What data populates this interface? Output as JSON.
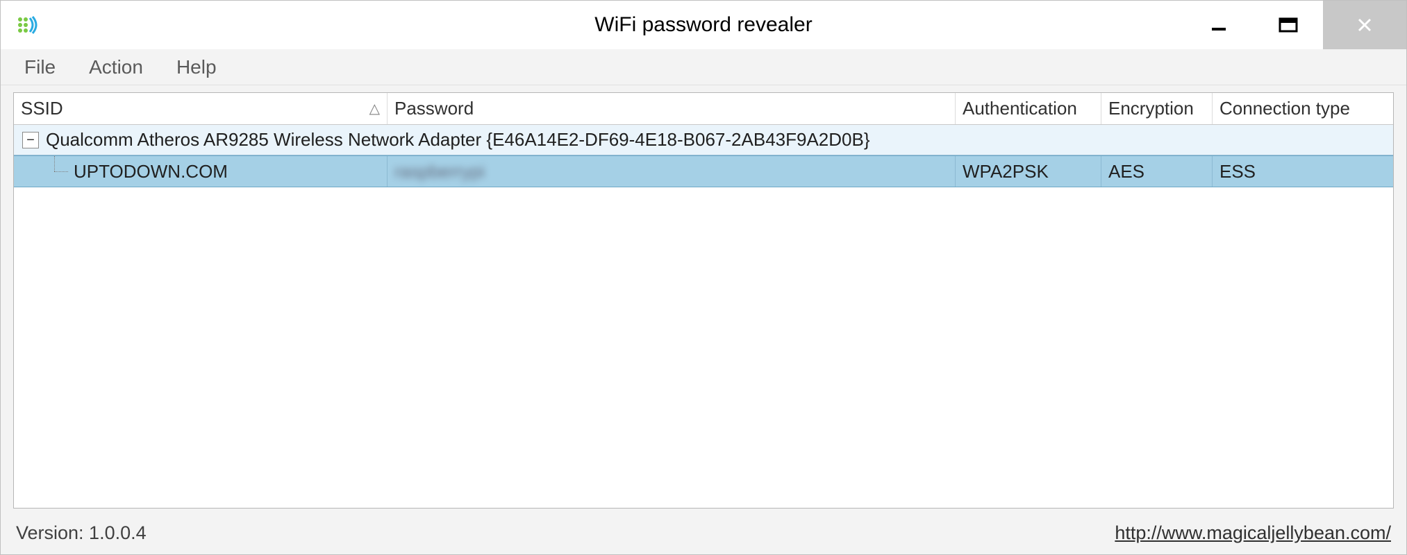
{
  "window": {
    "title": "WiFi password revealer"
  },
  "menu": {
    "file": "File",
    "action": "Action",
    "help": "Help"
  },
  "columns": {
    "ssid": "SSID",
    "password": "Password",
    "auth": "Authentication",
    "encryption": "Encryption",
    "connection": "Connection type",
    "sort_glyph": "△"
  },
  "group": {
    "expand_glyph": "−",
    "label": "Qualcomm Atheros AR9285 Wireless Network Adapter {E46A14E2-DF69-4E18-B067-2AB43F9A2D0B}"
  },
  "rows": [
    {
      "ssid": "UPTODOWN.COM",
      "password": "raspberrypi",
      "auth": "WPA2PSK",
      "encryption": "AES",
      "connection": "ESS"
    }
  ],
  "status": {
    "version_label": "Version: 1.0.0.4",
    "link": "http://www.magicaljellybean.com/"
  }
}
